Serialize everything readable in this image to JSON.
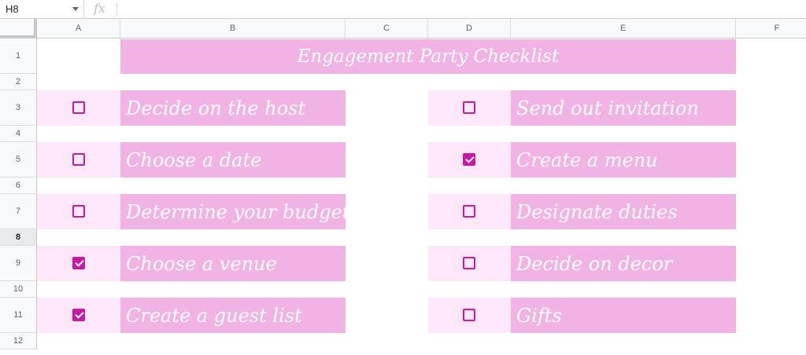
{
  "formula_bar": {
    "name_box": "H8",
    "fx_label": "fx",
    "formula": ""
  },
  "columns": [
    "A",
    "B",
    "C",
    "D",
    "E",
    "F"
  ],
  "rows": [
    "1",
    "2",
    "3",
    "4",
    "5",
    "6",
    "7",
    "8",
    "9",
    "10",
    "11",
    "12"
  ],
  "selected_row": "8",
  "sheet": {
    "title": "Engagement Party Checklist",
    "left_tasks": [
      {
        "label": "Decide on the host",
        "checked": false
      },
      {
        "label": "Choose a date",
        "checked": false
      },
      {
        "label": "Determine your budget",
        "checked": false
      },
      {
        "label": "Choose a venue",
        "checked": true
      },
      {
        "label": "Create a guest list",
        "checked": true
      }
    ],
    "right_tasks": [
      {
        "label": "Send out invitation",
        "checked": false
      },
      {
        "label": "Create a menu",
        "checked": true
      },
      {
        "label": "Designate duties",
        "checked": false
      },
      {
        "label": "Decide on decor",
        "checked": false
      },
      {
        "label": "Gifts",
        "checked": false
      }
    ]
  },
  "colors": {
    "accent": "#c51aa6",
    "label_bg": "#f1b3e3",
    "checkbox_bg": "#fde7f8"
  }
}
